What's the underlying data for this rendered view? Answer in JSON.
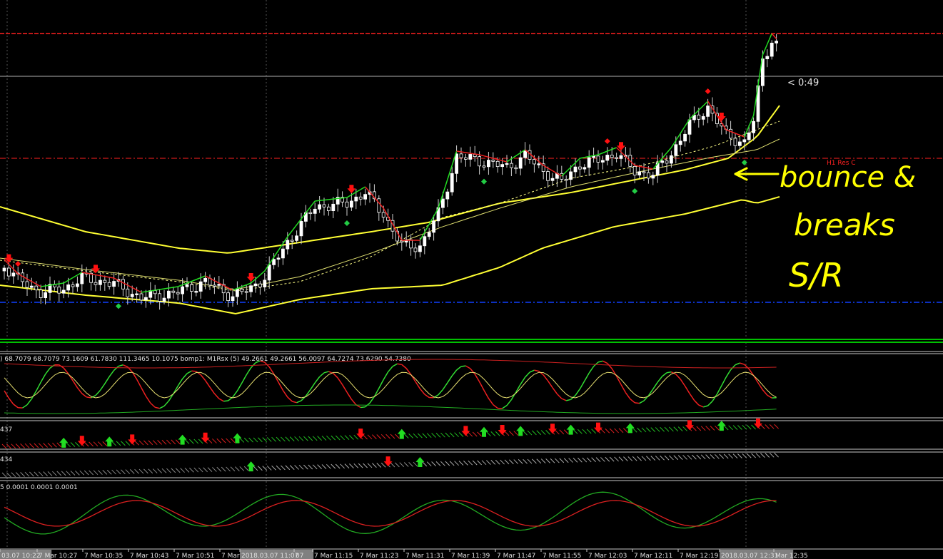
{
  "chart_data": {
    "type": "candlestick",
    "main": {
      "price_timer": "< 0:49",
      "level_labels": {
        "h1_res_c": "H1 Res C"
      },
      "colors": {
        "bull": "#ffffff",
        "bear": "#ffffff",
        "env": "#ffff33",
        "res": "#ff2020",
        "sup": "#1040ff"
      },
      "signal_arrows": [
        {
          "i": 1,
          "dir": "down"
        },
        {
          "i": 20,
          "dir": "down"
        },
        {
          "i": 54,
          "dir": "down"
        },
        {
          "i": 76,
          "dir": "down"
        },
        {
          "i": 135,
          "dir": "down"
        },
        {
          "i": 157,
          "dir": "down"
        }
      ],
      "diamonds": [
        {
          "i": 3,
          "color": "red"
        },
        {
          "i": 25,
          "color": "green"
        },
        {
          "i": 75,
          "color": "green"
        },
        {
          "i": 105,
          "color": "green"
        },
        {
          "i": 132,
          "color": "red"
        },
        {
          "i": 138,
          "color": "green"
        },
        {
          "i": 154,
          "color": "red"
        },
        {
          "i": 162,
          "color": "green"
        }
      ]
    },
    "panels": [
      {
        "id": "rsx",
        "title": ") 68.7079 68.7079 73.1609 61.7830 111.3465 10.1075 bomp1: M1Rsx (5) 49.2661 49.2661 56.0097 64.7274 73.6290 54.7380"
      },
      {
        "id": "arrows1",
        "title": "437",
        "signals": [
          {
            "i": 13,
            "dir": "up"
          },
          {
            "i": 17,
            "dir": "down"
          },
          {
            "i": 23,
            "dir": "up"
          },
          {
            "i": 28,
            "dir": "down"
          },
          {
            "i": 39,
            "dir": "up"
          },
          {
            "i": 44,
            "dir": "down"
          },
          {
            "i": 51,
            "dir": "up"
          },
          {
            "i": 78,
            "dir": "down"
          },
          {
            "i": 87,
            "dir": "up"
          },
          {
            "i": 101,
            "dir": "down"
          },
          {
            "i": 105,
            "dir": "up"
          },
          {
            "i": 109,
            "dir": "down"
          },
          {
            "i": 113,
            "dir": "up"
          },
          {
            "i": 120,
            "dir": "down"
          },
          {
            "i": 124,
            "dir": "up"
          },
          {
            "i": 130,
            "dir": "down"
          },
          {
            "i": 137,
            "dir": "up"
          },
          {
            "i": 150,
            "dir": "down"
          },
          {
            "i": 157,
            "dir": "up"
          },
          {
            "i": 165,
            "dir": "down"
          }
        ]
      },
      {
        "id": "arrows2",
        "title": "434",
        "signals": [
          {
            "i": 54,
            "dir": "up"
          },
          {
            "i": 84,
            "dir": "down"
          },
          {
            "i": 91,
            "dir": "up"
          }
        ]
      },
      {
        "id": "osc",
        "title": "5 0.0001 0.0001 0.0001"
      }
    ],
    "x_ticks": [
      {
        "label": "03.07 10:22",
        "highlight": true
      },
      {
        "label": "7 Mar 10:27"
      },
      {
        "label": "7 Mar 10:35"
      },
      {
        "label": "7 Mar 10:43"
      },
      {
        "label": "7 Mar 10:51"
      },
      {
        "label": "7 Mar"
      },
      {
        "label": "2018.03.07 11:07",
        "highlight": true
      },
      {
        "label": "07"
      },
      {
        "label": "7 Mar 11:15"
      },
      {
        "label": "7 Mar 11:23"
      },
      {
        "label": "7 Mar 11:31"
      },
      {
        "label": "7 Mar 11:39"
      },
      {
        "label": "7 Mar 11:47"
      },
      {
        "label": "7 Mar 11:55"
      },
      {
        "label": "7 Mar 12:03"
      },
      {
        "label": "7 Mar 12:11"
      },
      {
        "label": "7 Mar 12:19"
      },
      {
        "label": "2018.03.07 12:31",
        "highlight": true
      },
      {
        "label": "Mar 12:35"
      }
    ],
    "annotation": {
      "text": [
        "bounce &",
        "breaks",
        "S/R"
      ],
      "color": "#ffff00"
    }
  }
}
